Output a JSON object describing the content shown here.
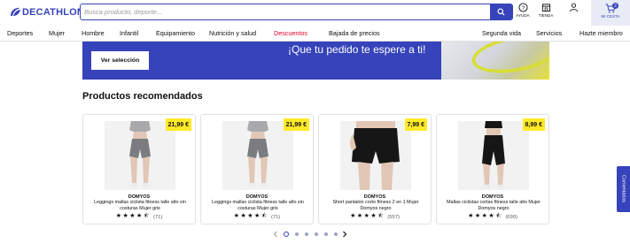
{
  "brand": {
    "logo_text": "DECATHLON",
    "color": "#3643ba"
  },
  "search": {
    "placeholder": "Busca producto, deporte..."
  },
  "header": {
    "help_label": "AYUDA",
    "store_label": "TIENDA",
    "cart_label": "MI CESTA",
    "cart_count": "2"
  },
  "nav": {
    "items": [
      {
        "label": "Deportes"
      },
      {
        "label": "Mujer"
      },
      {
        "label": "Hombre"
      },
      {
        "label": "Infantil"
      },
      {
        "label": "Equipamiento"
      },
      {
        "label": "Nutrición y salud"
      },
      {
        "label": "Descuentos"
      },
      {
        "label": "Bajada de precios"
      },
      {
        "label": "Segunda vida"
      },
      {
        "label": "Servicios"
      },
      {
        "label": "Hazte miembro"
      }
    ],
    "promo_color": "#e4002b"
  },
  "banner": {
    "button_label": "Ver selección",
    "text": "¡Que tu pedido te espere a ti!"
  },
  "recommended": {
    "title": "Productos recomendados",
    "products": [
      {
        "price": "21,99 €",
        "brand": "DOMYOS",
        "name": "Leggings mallas ciclista fitness talle alto sin costuras Mujer gris",
        "stars": "★★★★⯪",
        "reviews": "(71)",
        "image": "grey-shorts"
      },
      {
        "price": "21,99 €",
        "brand": "DOMYOS",
        "name": "Leggings mallas ciclista fitness talle alto sin costuras Mujer gris",
        "stars": "★★★★⯪",
        "reviews": "(71)",
        "image": "grey-shorts"
      },
      {
        "price": "7,99 €",
        "brand": "DOMYOS",
        "name": "Short pantalon corto fitness 2 en 1 Mujer Domyos negro",
        "stars": "★★★★⯪",
        "reviews": "(557)",
        "image": "black-shorts"
      },
      {
        "price": "8,99 €",
        "brand": "DOMYOS",
        "name": "Mallas ciclistas cortas fitness talle alto Mujer Domyos negro",
        "stars": "★★★★⯪",
        "reviews": "(690)",
        "image": "black-cycling-shorts"
      }
    ],
    "price_badge_color": "#ffea28"
  },
  "carousel": {
    "pages": 6,
    "active": 0
  },
  "feedback": {
    "label": "Comentarios"
  }
}
